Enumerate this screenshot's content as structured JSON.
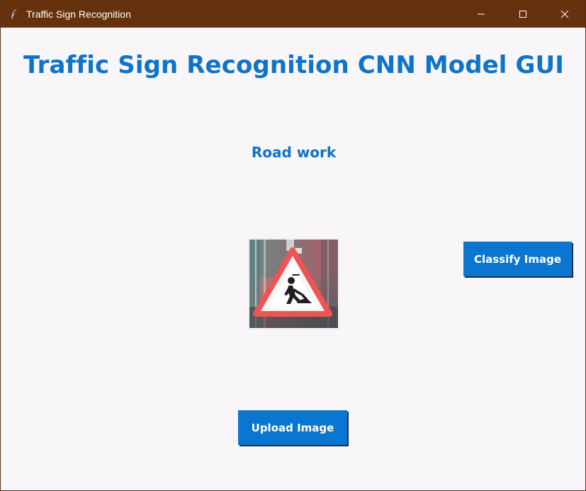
{
  "window": {
    "title": "Traffic Sign Recognition",
    "controls": [
      "minimize",
      "maximize",
      "close"
    ]
  },
  "main": {
    "heading": "Traffic Sign Recognition CNN Model GUI",
    "prediction": "Road work",
    "image": {
      "type": "traffic-sign",
      "description_icon": "road-work-sign-icon"
    },
    "buttons": {
      "classify": "Classify Image",
      "upload": "Upload Image"
    }
  },
  "colors": {
    "titlebar": "#66320e",
    "background": "#f8f6f8",
    "accent": "#0f73c8",
    "button": "#0a76cf"
  }
}
